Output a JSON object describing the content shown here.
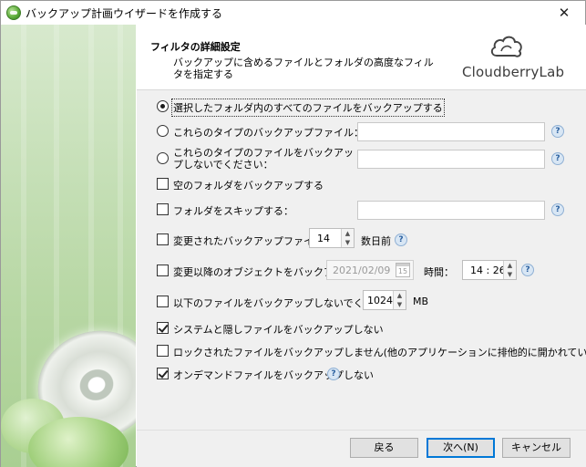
{
  "window": {
    "title": "バックアップ計画ウイザードを作成する",
    "close_glyph": "✕"
  },
  "header": {
    "title": "フィルタの詳細設定",
    "description": "バックアップに含めるファイルとフォルダの高度なフィルタを指定する",
    "logo_text": "CloudberryLab"
  },
  "options": {
    "radio_all": "選択したフォルダ内のすべてのファイルをバックアップする",
    "radio_types": "これらのタイプのバックアップファイル：",
    "radio_types_value": "",
    "radio_exclude": "これらのタイプのファイルをバックアップしないでください：",
    "radio_exclude_value": "",
    "empty_folders": "空のフォルダをバックアップする",
    "skip_folders": "フォルダをスキップする：",
    "skip_folders_value": "",
    "modified_files": "変更されたバックアップファイル：",
    "modified_days_value": "14",
    "modified_days_unit": "数日前",
    "modified_since": "変更以降のオブジェクトをバックアップ",
    "modified_since_date": "2021/02/09",
    "calendar_day": "15",
    "time_label": "時間：",
    "time_value": "14 : 26",
    "size_limit": "以下のファイルをバックアップしないでください：",
    "size_limit_value": "1024",
    "size_limit_unit": "MB",
    "system_hidden": "システムと隠しファイルをバックアップしない",
    "locked_files": "ロックされたファイルをバックアップしません(他のアプリケーションに排他的に開かれている)",
    "ondemand_files": "オンデマンドファイルをバックアップしない",
    "help_glyph": "?"
  },
  "footer": {
    "back": "戻る",
    "next": "次へ(N)",
    "cancel": "キャンセル"
  }
}
